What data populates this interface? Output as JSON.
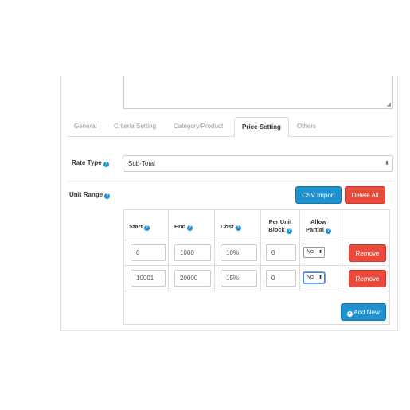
{
  "tabs": [
    {
      "label": "General",
      "active": false
    },
    {
      "label": "Criteria Setting",
      "active": false
    },
    {
      "label": "Category/Product",
      "active": false
    },
    {
      "label": "Price Setting",
      "active": true
    },
    {
      "label": "Others",
      "active": false
    }
  ],
  "rate_type": {
    "label": "Rate Type",
    "value": "Sub-Total",
    "help_icon": "question-circle-icon"
  },
  "unit_range": {
    "label": "Unit Range",
    "help_icon": "question-circle-icon",
    "csv_import_label": "CSV Import",
    "delete_all_label": "Delete All",
    "add_new_label": "Add New",
    "columns": {
      "start": "Start",
      "end": "End",
      "cost": "Cost",
      "per_unit_block_1": "Per Unit",
      "per_unit_block_2": "Block",
      "allow_partial_1": "Allow",
      "allow_partial_2": "Partial"
    },
    "rows": [
      {
        "start": "0",
        "end": "1000",
        "cost": "10%",
        "per_unit_block": "0",
        "allow_partial": "No",
        "remove_label": "Remove"
      },
      {
        "start": "10001",
        "end": "20000",
        "cost": "15%",
        "per_unit_block": "0",
        "allow_partial": "No",
        "remove_label": "Remove"
      }
    ]
  },
  "colors": {
    "primary": "#1e91cf",
    "danger": "#e84b3c"
  }
}
